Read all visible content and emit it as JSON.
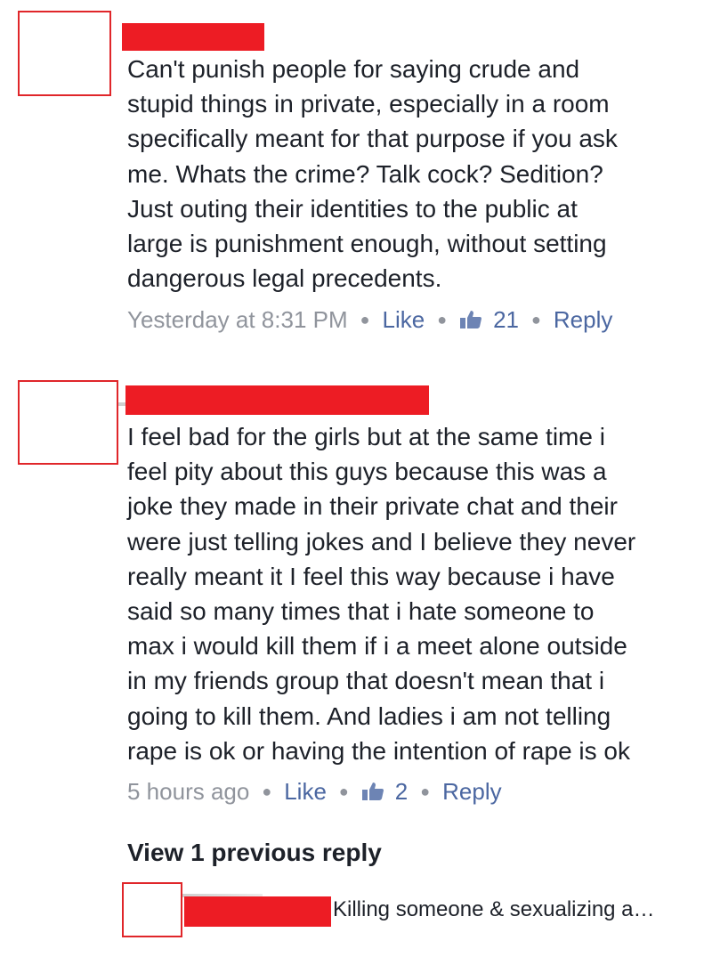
{
  "comments": [
    {
      "lines": [
        "Can't punish people for saying crude and",
        "stupid things in private, especially in a room",
        "specifically meant for that purpose if you ask",
        "me. Whats the crime? Talk cock? Sedition?",
        "Just outing their identities to the public at",
        "large is punishment enough, without setting",
        "dangerous legal precedents."
      ],
      "timestamp": "Yesterday at 8:31 PM",
      "like_label": "Like",
      "like_count": "21",
      "reply_label": "Reply"
    },
    {
      "lines": [
        "I feel bad for the girls but at the same time i",
        "feel pity about this guys because this was a",
        "joke they made in their private chat and their",
        "were just telling jokes and I believe they never",
        "really meant it I feel this way because i have",
        "said so many times that i hate someone to",
        "max i would kill them if i a meet alone outside",
        "in my friends group that doesn't mean that i",
        "going to kill them. And ladies i am not telling",
        "rape is ok or having the intention of rape is ok"
      ],
      "timestamp": "5 hours ago",
      "like_label": "Like",
      "like_count": "2",
      "reply_label": "Reply"
    }
  ],
  "view_previous_replies": "View 1 previous reply",
  "reply_preview": {
    "text": "Killing someone & sexualizing a…"
  },
  "icons": {
    "redacted_avatar": "redacted-avatar-box",
    "redacted_name": "redacted-name-bar",
    "thumbs_up": "thumbs-up-icon"
  },
  "colors": {
    "redaction": "#ed1c24",
    "link": "#4b67a1",
    "meta": "#90949c",
    "text": "#1d2129"
  }
}
